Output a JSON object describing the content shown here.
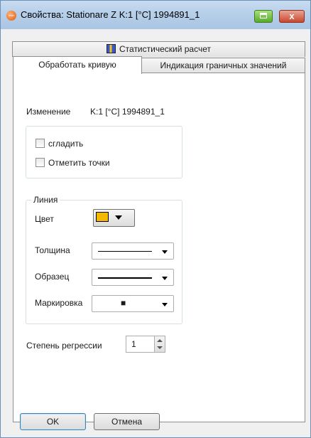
{
  "window": {
    "title": "Свойства: Stationare Z K:1 [°C] 1994891_1",
    "app_icon_label": "testo",
    "close_glyph": "x"
  },
  "tabs": {
    "statistics": "Статистический расчет",
    "curve": "Обработать кривую",
    "limits": "Индикация граничных значений"
  },
  "change": {
    "label": "Изменение",
    "value": "K:1 [°C] 1994891_1"
  },
  "options": {
    "smooth": {
      "label": "сгладить",
      "checked": false
    },
    "mark_points": {
      "label": "Отметить точки",
      "checked": false
    }
  },
  "line_group": {
    "title": "Линия",
    "color_label": "Цвет",
    "color_value": "#f5b800",
    "thickness_label": "Толщина",
    "pattern_label": "Образец",
    "marker_label": "Маркировка",
    "marker_value": "■"
  },
  "regression": {
    "label": "Степень регрессии",
    "value": "1"
  },
  "buttons": {
    "ok": "OK",
    "cancel": "Отмена"
  }
}
